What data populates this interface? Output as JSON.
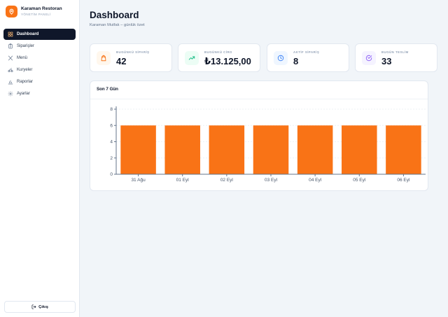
{
  "brand": {
    "name": "Karaman Restoran",
    "subtitle": "YÖNETİM PANELİ"
  },
  "nav": [
    {
      "label": "Dashboard",
      "icon": "grid-icon",
      "active": true
    },
    {
      "label": "Siparişler",
      "icon": "clipboard-icon",
      "active": false
    },
    {
      "label": "Menü",
      "icon": "utensils-icon",
      "active": false
    },
    {
      "label": "Kuryeler",
      "icon": "bike-icon",
      "active": false
    },
    {
      "label": "Raporlar",
      "icon": "bar-chart-icon",
      "active": false
    },
    {
      "label": "Ayarlar",
      "icon": "gear-icon",
      "active": false
    }
  ],
  "logout": {
    "label": "Çıkış",
    "icon": "logout-icon"
  },
  "page": {
    "title": "Dashboard",
    "subtitle": "Karaman Mutfak – günlük özet"
  },
  "stats": [
    {
      "label": "BUGÜNKÜ SİPARİŞ",
      "value": "42",
      "icon": "shopping-bag-icon",
      "color": "#f97316",
      "bg": "#fff7ed"
    },
    {
      "label": "BUGÜNKÜ CİRO",
      "value": "₺13.125,00",
      "icon": "trending-up-icon",
      "color": "#10b981",
      "bg": "#ecfdf5"
    },
    {
      "label": "AKTİF SİPARİŞ",
      "value": "8",
      "icon": "clock-icon",
      "color": "#3b82f6",
      "bg": "#eff6ff"
    },
    {
      "label": "BUGÜN TESLİM",
      "value": "33",
      "icon": "check-circle-icon",
      "color": "#8b5cf6",
      "bg": "#f5f3ff"
    }
  ],
  "chart": {
    "title": "Son 7 Gün"
  },
  "chart_data": {
    "type": "bar",
    "categories": [
      "31 Ağu",
      "01 Eyl",
      "02 Eyl",
      "03 Eyl",
      "04 Eyl",
      "05 Eyl",
      "06 Eyl"
    ],
    "values": [
      6,
      6,
      6,
      6,
      6,
      6,
      6
    ],
    "ylim": [
      0,
      8
    ],
    "yticks": [
      0,
      2,
      4,
      6,
      8
    ],
    "grid": true,
    "bar_color": "#f97316",
    "title": "",
    "xlabel": "",
    "ylabel": ""
  },
  "colors": {
    "accent": "#f97316",
    "sidebar_active": "#0f172a"
  }
}
